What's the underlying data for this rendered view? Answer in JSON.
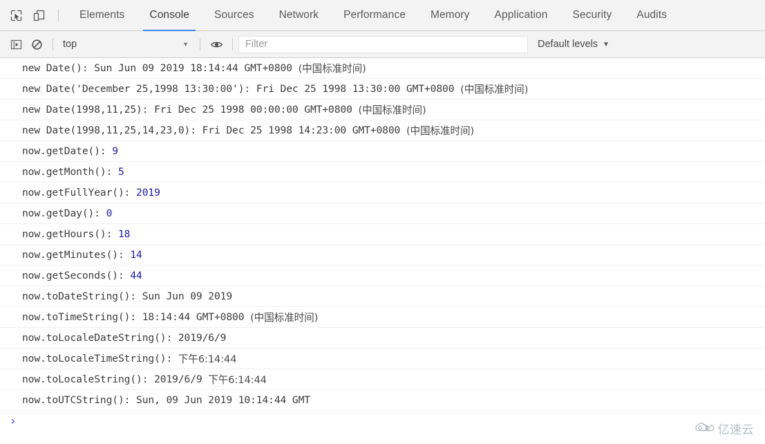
{
  "tabbar": {
    "inspect_icon": "inspect-cursor-icon",
    "device_icon": "device-toolbar-icon",
    "tabs": [
      {
        "label": "Elements",
        "active": false
      },
      {
        "label": "Console",
        "active": true
      },
      {
        "label": "Sources",
        "active": false
      },
      {
        "label": "Network",
        "active": false
      },
      {
        "label": "Performance",
        "active": false
      },
      {
        "label": "Memory",
        "active": false
      },
      {
        "label": "Application",
        "active": false
      },
      {
        "label": "Security",
        "active": false
      },
      {
        "label": "Audits",
        "active": false
      }
    ]
  },
  "toolbar": {
    "sidebar_icon": "console-sidebar-icon",
    "clear_icon": "clear-console-icon",
    "eye_icon": "live-expression-eye-icon",
    "context": "top",
    "context_caret": "▼",
    "filter_placeholder": "Filter",
    "levels_label": "Default levels",
    "levels_caret": "▼"
  },
  "console": {
    "messages": [
      {
        "label": "new Date(): ",
        "value": "Sun Jun 09 2019 18:14:44 GMT+0800 ",
        "cjk": "(中国标准时间)",
        "number": ""
      },
      {
        "label": "new Date('December 25,1998 13:30:00'): ",
        "value": "Fri Dec 25 1998 13:30:00 GMT+0800 ",
        "cjk": "(中国标准时间)",
        "number": ""
      },
      {
        "label": "new Date(1998,11,25): ",
        "value": "Fri Dec 25 1998 00:00:00 GMT+0800 ",
        "cjk": "(中国标准时间)",
        "number": ""
      },
      {
        "label": "new Date(1998,11,25,14,23,0): ",
        "value": "Fri Dec 25 1998 14:23:00 GMT+0800 ",
        "cjk": "(中国标准时间)",
        "number": ""
      },
      {
        "label": "now.getDate(): ",
        "value": "",
        "cjk": "",
        "number": "9"
      },
      {
        "label": "now.getMonth(): ",
        "value": "",
        "cjk": "",
        "number": "5"
      },
      {
        "label": "now.getFullYear(): ",
        "value": "",
        "cjk": "",
        "number": "2019"
      },
      {
        "label": "now.getDay(): ",
        "value": "",
        "cjk": "",
        "number": "0"
      },
      {
        "label": "now.getHours(): ",
        "value": "",
        "cjk": "",
        "number": "18"
      },
      {
        "label": "now.getMinutes(): ",
        "value": "",
        "cjk": "",
        "number": "14"
      },
      {
        "label": "now.getSeconds(): ",
        "value": "",
        "cjk": "",
        "number": "44"
      },
      {
        "label": "now.toDateString(): ",
        "value": "Sun Jun 09 2019",
        "cjk": "",
        "number": ""
      },
      {
        "label": "now.toTimeString(): ",
        "value": "18:14:44 GMT+0800 ",
        "cjk": "(中国标准时间)",
        "number": ""
      },
      {
        "label": "now.toLocaleDateString(): ",
        "value": "2019/6/9",
        "cjk": "",
        "number": ""
      },
      {
        "label": "now.toLocaleTimeString(): ",
        "value": "",
        "cjk": "下午6:14:44",
        "number": ""
      },
      {
        "label": "now.toLocaleString(): ",
        "value": "2019/6/9 ",
        "cjk": "下午6:14:44",
        "number": ""
      },
      {
        "label": "now.toUTCString(): ",
        "value": "Sun, 09 Jun 2019 10:14:44 GMT",
        "cjk": "",
        "number": ""
      }
    ],
    "prompt_chevron": "›"
  },
  "watermark": {
    "icon": "cloud-logo-icon",
    "text": "亿速云"
  },
  "colors": {
    "accent": "#4285f4",
    "number": "#1a1aa6",
    "prompt": "#3b57d8",
    "toolbar_bg": "#f3f3f3",
    "text": "#3b3b3b"
  }
}
